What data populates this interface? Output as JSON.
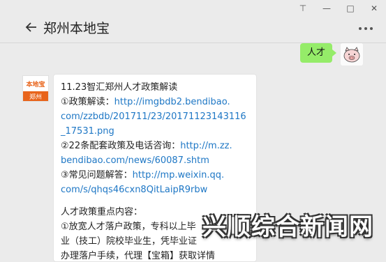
{
  "window": {
    "pin_label": "⊤",
    "minimize_label": "—",
    "maximize_label": "□",
    "close_label": "✕"
  },
  "header": {
    "title": "郑州本地宝",
    "back_icon": "arrow-left-icon",
    "more_icon": "more-dots-icon"
  },
  "outgoing": {
    "text": "人才"
  },
  "incoming": {
    "avatar_top": "本地宝",
    "avatar_bottom": "郑州",
    "lines": [
      {
        "pre": "11.23智汇郑州人才政策解读",
        "link": "",
        "post": ""
      },
      {
        "pre": "①政策解读：",
        "link": "http://imgbdb2.bendibao.",
        "post": ""
      },
      {
        "pre": "",
        "link": "com/zzbdb/201711/23/20171123143116",
        "post": ""
      },
      {
        "pre": "",
        "link": "_17531.png",
        "post": ""
      },
      {
        "pre": "②22条配套政策及电话咨询：",
        "link": "http://m.zz.",
        "post": ""
      },
      {
        "pre": "",
        "link": "bendibao.com/news/60087.shtm",
        "post": ""
      },
      {
        "pre": "③常见问题解答：",
        "link": "http://mp.weixin.qq.",
        "post": ""
      },
      {
        "pre": "",
        "link": "com/s/qhqs46cxn8QitLaipR9rbw",
        "post": ""
      }
    ],
    "lines2": [
      {
        "pre": "人才政策重点内容："
      },
      {
        "pre": "①放宽人才落户政策，专科以上毕"
      },
      {
        "pre": "业（技工）院校毕业生，凭毕业证"
      },
      {
        "pre": "办理落户手续，代理【宝箱】获取详情"
      }
    ]
  },
  "watermark": {
    "text": "兴顺综合新闻网"
  },
  "colors": {
    "bubble_green": "#95ec69",
    "link_blue": "#1e77c5",
    "brand_orange": "#e8641b"
  }
}
